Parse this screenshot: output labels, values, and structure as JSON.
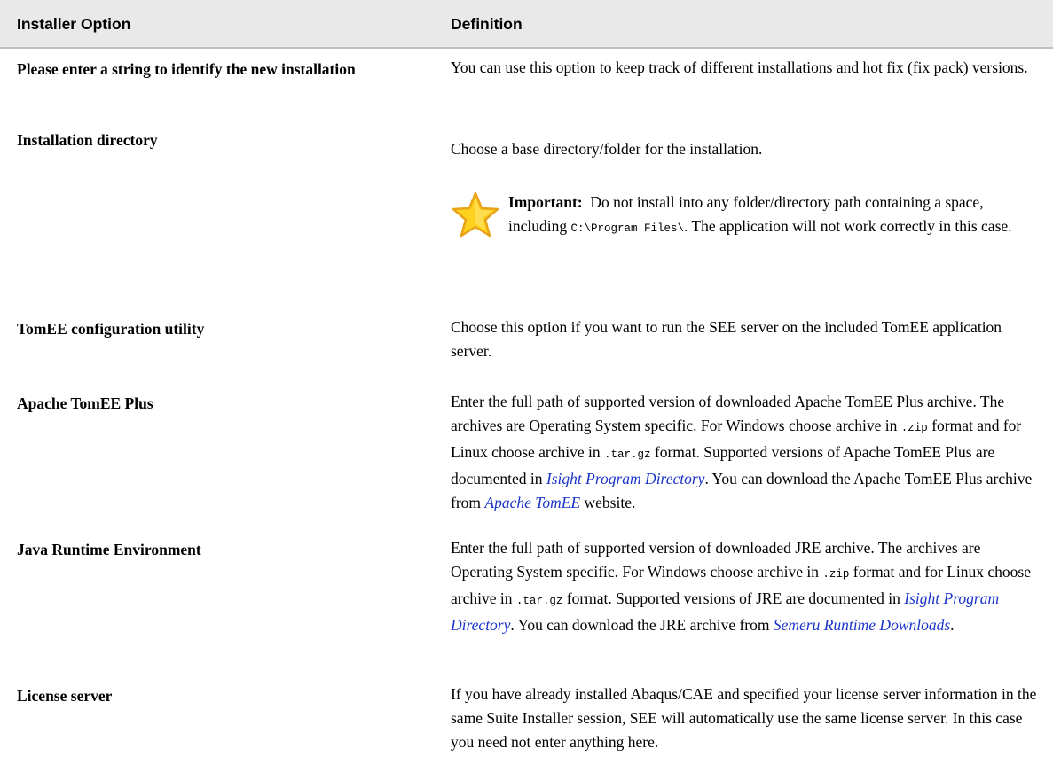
{
  "header": {
    "col1": "Installer Option",
    "col2": "Definition"
  },
  "rows": [
    {
      "option": "Please enter a string to identify the new installation",
      "definition": "You can use this option to keep track of different installations and hot fix (fix pack) versions."
    },
    {
      "option": "Installation directory",
      "definition": "Choose a base directory/folder for the installation.",
      "note": {
        "icon": "star-icon",
        "label": "Important:",
        "text_before": "Do not install into any folder/directory path containing a space, including",
        "code": "C:\\Program Files\\",
        "text_after": ". The application will not work correctly in this case."
      }
    },
    {
      "option": "TomEE configuration utility",
      "definition": "Choose this option if you want to run the SEE server on the included TomEE application server."
    },
    {
      "option": "Apache TomEE Plus",
      "def_part1": "Enter the full path of supported version of downloaded Apache TomEE Plus archive. The archives are Operating System specific. For Windows choose archive in",
      "code1": ".zip",
      "def_part2": "format and for Linux choose archive in",
      "code2": ".tar.gz",
      "def_part3": "format. Supported versions of Apache TomEE Plus are documented in",
      "link1": "Isight Program Directory",
      "def_part4": ". You can download the Apache TomEE Plus archive from",
      "link2": "Apache TomEE",
      "def_part5": "website."
    },
    {
      "option": "Java Runtime Environment",
      "def_part1": "Enter the full path of supported version of downloaded JRE archive. The archives are Operating System specific. For Windows choose archive in",
      "code1": ".zip",
      "def_part2": "format and for Linux choose archive in",
      "code2": ".tar.gz",
      "def_part3": "format. Supported versions of JRE are documented in",
      "link1": "Isight Program Directory",
      "def_part4": ". You can download the JRE archive from",
      "link2": "Semeru Runtime Downloads",
      "def_part5": "."
    },
    {
      "option": "License server",
      "definition": "If you have already installed Abaqus/CAE and specified your license server information in the same Suite Installer session, SEE will automatically use the same license server. In this case you need not enter anything here."
    }
  ],
  "colors": {
    "link": "#1a35c8",
    "header_bg": "#e9e9e9",
    "star_fill": "#ffd21f",
    "star_stroke": "#e8a317"
  }
}
